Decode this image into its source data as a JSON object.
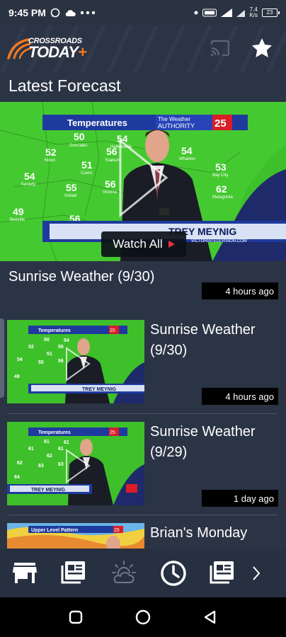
{
  "status_bar": {
    "time": "9:45 PM",
    "net_speed_value": "7.4",
    "net_speed_unit": "K/s",
    "battery": "23"
  },
  "header": {
    "logo_top": "CROSSROADS",
    "logo_bottom": "TODAY",
    "logo_plus": "+"
  },
  "section_title": "Latest Forecast",
  "hero": {
    "watch_all_label": "Watch All",
    "title": "Sunrise Weather (9/30)",
    "time_ago": "4 hours ago",
    "video": {
      "banner": "Temperatures",
      "brand_top": "The Weather",
      "brand_bottom": "AUTHORITY",
      "channel": "25",
      "presenter": "TREY MEYNIG",
      "website": "VICTORIATELEVISION.COM",
      "map_values": [
        "50",
        "54",
        "52",
        "56",
        "51",
        "54",
        "53",
        "54",
        "55",
        "56",
        "62",
        "49",
        "56"
      ],
      "map_places": [
        "Gonzales",
        "Hallettsville",
        "Nixon",
        "Yoakum",
        "Cuero",
        "Wharton",
        "Bay City",
        "Kenedy",
        "Goliad",
        "Victoria",
        "Matagorda",
        "Beeville"
      ]
    }
  },
  "list": [
    {
      "title": "Sunrise Weather (9/30)",
      "time_ago": "4 hours ago",
      "thumb_banner": "Temperatures",
      "thumb_presenter": "TREY MEYNIG",
      "thumb_channel": "25"
    },
    {
      "title": "Sunrise Weather (9/29)",
      "time_ago": "1 day ago",
      "thumb_banner": "Temperatures",
      "thumb_presenter": "TREY MEYNIG",
      "thumb_channel": "25"
    },
    {
      "title": "Brian's Monday",
      "time_ago": "",
      "thumb_banner": "Upper Level Pattern",
      "thumb_presenter": "",
      "thumb_channel": "25"
    }
  ],
  "bottom_nav": [
    {
      "icon": "store-icon"
    },
    {
      "icon": "news-icon"
    },
    {
      "icon": "weather-icon"
    },
    {
      "icon": "clock-icon"
    },
    {
      "icon": "news-icon"
    }
  ],
  "colors": {
    "app_bg": "#2b3445",
    "nav_bg": "#273041",
    "accent_orange": "#f47a20",
    "map_green": "#3ec02a",
    "banner_blue": "#1e3a9e",
    "channel_red": "#d91e28"
  }
}
